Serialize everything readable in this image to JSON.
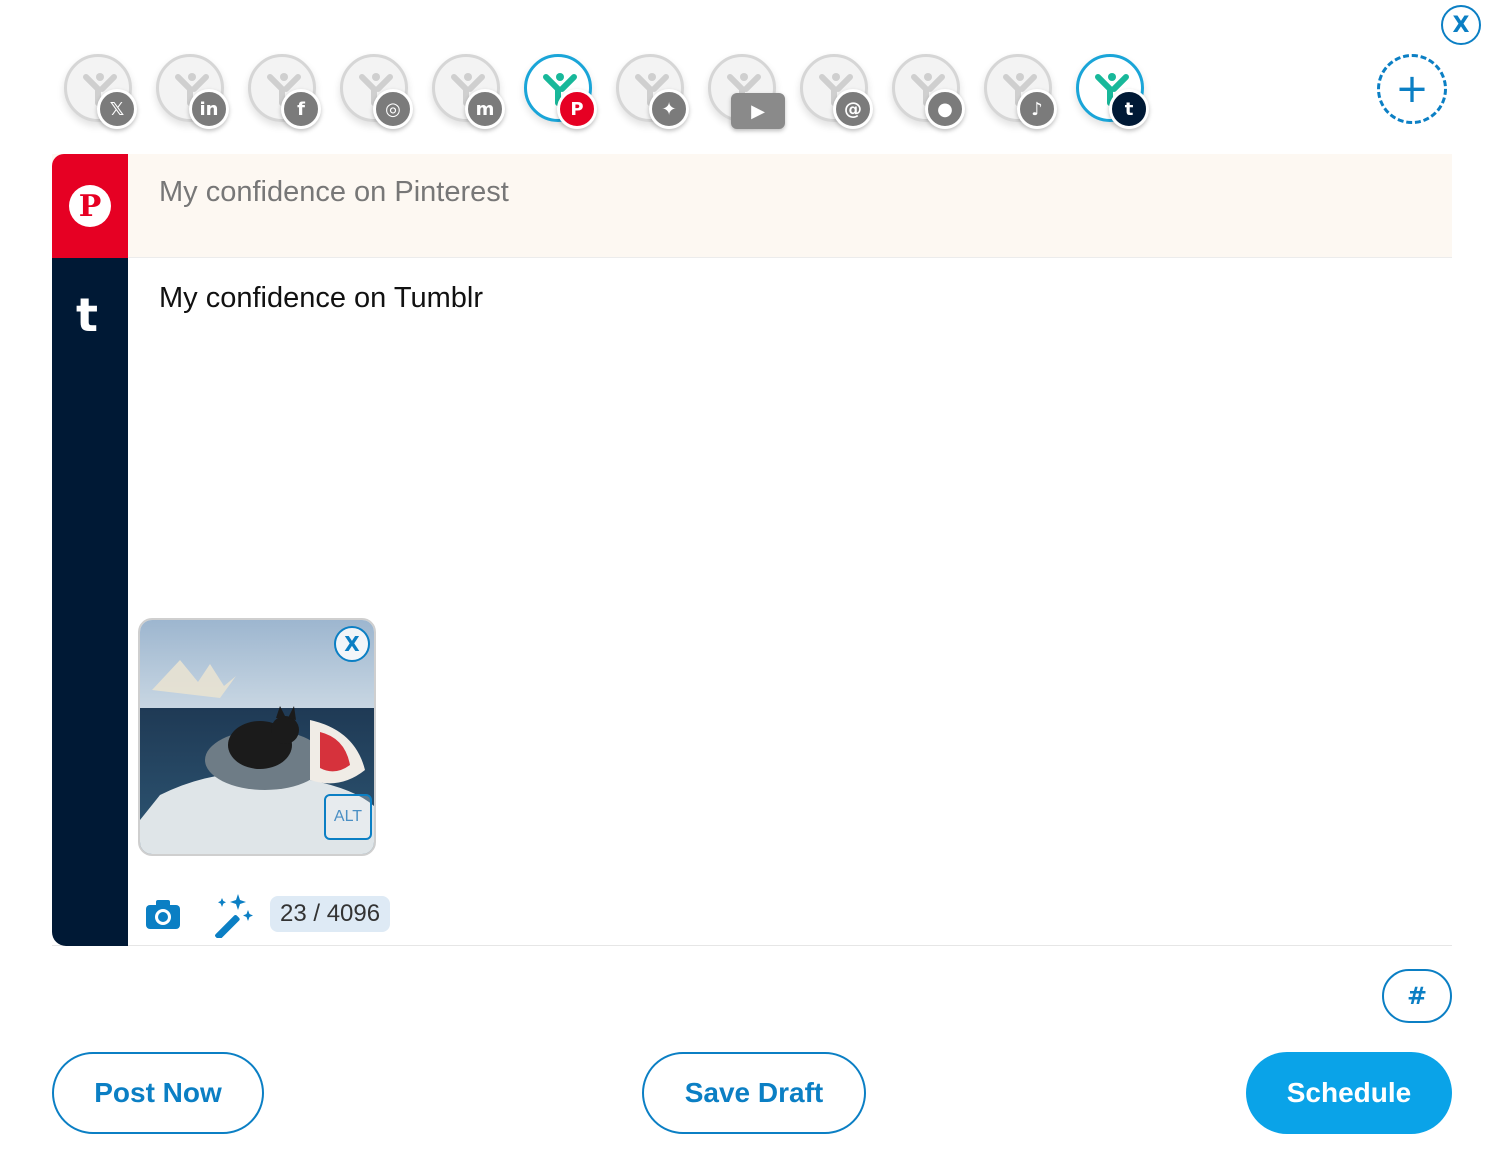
{
  "dialog": {
    "close_label": "X"
  },
  "accounts": [
    {
      "network": "X",
      "badge": "𝕏",
      "active": false,
      "badge_icon": "x-logo-icon"
    },
    {
      "network": "LinkedIn",
      "badge": "in",
      "active": false,
      "badge_icon": "linkedin-logo-icon"
    },
    {
      "network": "Facebook",
      "badge": "f",
      "active": false,
      "badge_icon": "facebook-logo-icon"
    },
    {
      "network": "Instagram",
      "badge": "◎",
      "active": false,
      "badge_icon": "instagram-logo-icon"
    },
    {
      "network": "Mastodon",
      "badge": "m",
      "active": false,
      "badge_icon": "mastodon-logo-icon"
    },
    {
      "network": "Pinterest",
      "badge": "P",
      "active": true,
      "badge_icon": "pinterest-logo-icon"
    },
    {
      "network": "Bluesky",
      "badge": "✦",
      "active": false,
      "badge_icon": "bluesky-logo-icon"
    },
    {
      "network": "YouTube",
      "badge": "▶",
      "active": false,
      "badge_icon": "youtube-logo-icon"
    },
    {
      "network": "Threads",
      "badge": "@",
      "active": false,
      "badge_icon": "threads-logo-icon"
    },
    {
      "network": "Patreon",
      "badge": "●",
      "active": false,
      "badge_icon": "patreon-logo-icon"
    },
    {
      "network": "TikTok",
      "badge": "♪",
      "active": false,
      "badge_icon": "tiktok-logo-icon"
    },
    {
      "network": "Tumblr",
      "badge": "t",
      "active": true,
      "badge_icon": "tumblr-logo-icon"
    }
  ],
  "add_account": {
    "label": "+"
  },
  "posts": {
    "pinterest": {
      "text": "My confidence on Pinterest",
      "logo": "P",
      "color": "#e60023"
    },
    "tumblr": {
      "text": "My confidence on Tumblr",
      "logo": "t",
      "color": "#001935"
    }
  },
  "media": {
    "remove_label": "X",
    "alt_label": "ALT"
  },
  "toolbar": {
    "counter": "23 / 4096"
  },
  "hashtag": {
    "label": "#"
  },
  "actions": {
    "post_now": "Post Now",
    "save_draft": "Save Draft",
    "schedule": "Schedule"
  },
  "colors": {
    "accent": "#0b7fc4",
    "schedule": "#0aa3e8",
    "pinterest": "#e60023",
    "tumblr": "#001935"
  }
}
